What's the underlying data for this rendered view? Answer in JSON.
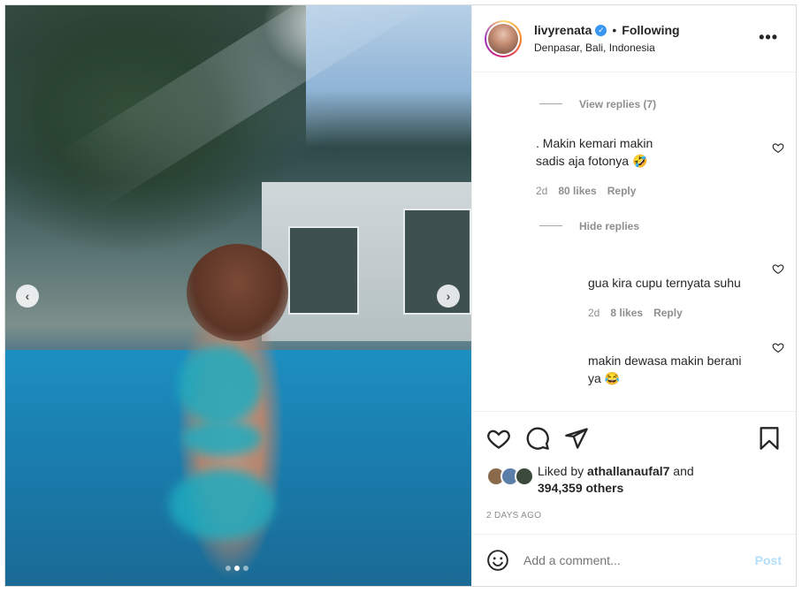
{
  "post": {
    "username": "livyrenata",
    "separator": "•",
    "follow_state": "Following",
    "location": "Denpasar, Bali, Indonesia",
    "more_icon": "more-horizontal-icon",
    "verified_icon": "verified-badge-icon"
  },
  "carousel": {
    "prev_icon": "chevron-left-icon",
    "next_icon": "chevron-right-icon",
    "slide_count": 3,
    "active_slide": 2
  },
  "comments": {
    "view_replies": "View replies (7)",
    "c1_text_line1": ". Makin kemari makin",
    "c1_text_line2": "sadis aja fotonya 🤣",
    "c1_age": "2d",
    "c1_likes": "80 likes",
    "c1_reply": "Reply",
    "hide_replies": "Hide replies",
    "r1_text": "gua kira cupu ternyata suhu",
    "r1_age": "2d",
    "r1_likes": "8 likes",
    "r1_reply": "Reply",
    "r2_text_line1": "makin dewasa makin berani",
    "r2_text_line2": "ya 😂"
  },
  "actions": {
    "like_icon": "heart-icon",
    "comment_icon": "comment-icon",
    "share_icon": "send-icon",
    "save_icon": "bookmark-icon"
  },
  "likes": {
    "prefix": "Liked by ",
    "user": "athallanaufal7",
    "mid": " and",
    "count": "394,359 others"
  },
  "time_ago": "2 DAYS AGO",
  "add_comment": {
    "placeholder": "Add a comment...",
    "post_label": "Post",
    "emoji_icon": "emoji-icon"
  },
  "colors": {
    "link_blue": "#b2dffc",
    "verified_blue": "#3897f0",
    "muted": "#8e8e8e"
  }
}
